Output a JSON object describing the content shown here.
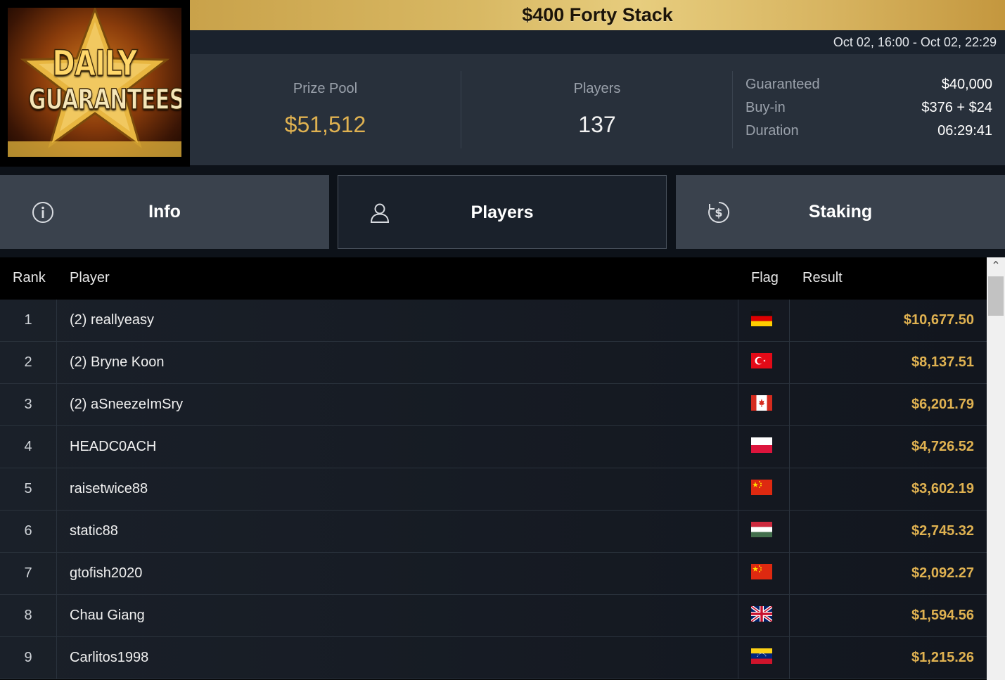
{
  "logo": {
    "line1": "DAILY",
    "line2": "GUARANTEES"
  },
  "tournament": {
    "title": "$400 Forty Stack",
    "date_range": "Oct 02, 16:00 - Oct 02, 22:29"
  },
  "stats": {
    "prize_pool_label": "Prize Pool",
    "prize_pool_value": "$51,512",
    "players_label": "Players",
    "players_value": "137"
  },
  "details": [
    {
      "label": "Guaranteed",
      "value": "$40,000"
    },
    {
      "label": "Buy-in",
      "value": "$376 + $24"
    },
    {
      "label": "Duration",
      "value": "06:29:41"
    }
  ],
  "tabs": [
    {
      "label": "Info",
      "icon": "info-icon",
      "active": false
    },
    {
      "label": "Players",
      "icon": "user-icon",
      "active": true
    },
    {
      "label": "Staking",
      "icon": "dollar-coin-icon",
      "active": false
    }
  ],
  "table": {
    "headers": {
      "rank": "Rank",
      "player": "Player",
      "flag": "Flag",
      "result": "Result"
    },
    "rows": [
      {
        "rank": "1",
        "player": "(2) reallyeasy",
        "flag": "germany",
        "result": "$10,677.50"
      },
      {
        "rank": "2",
        "player": "(2) Bryne Koon",
        "flag": "turkey",
        "result": "$8,137.51"
      },
      {
        "rank": "3",
        "player": "(2) aSneezeImSry",
        "flag": "canada",
        "result": "$6,201.79"
      },
      {
        "rank": "4",
        "player": "HEADC0ACH",
        "flag": "poland",
        "result": "$4,726.52"
      },
      {
        "rank": "5",
        "player": "raisetwice88",
        "flag": "china",
        "result": "$3,602.19"
      },
      {
        "rank": "6",
        "player": "static88",
        "flag": "hungary",
        "result": "$2,745.32"
      },
      {
        "rank": "7",
        "player": "gtofish2020",
        "flag": "china",
        "result": "$2,092.27"
      },
      {
        "rank": "8",
        "player": "Chau Giang",
        "flag": "united-kingdom",
        "result": "$1,594.56"
      },
      {
        "rank": "9",
        "player": "Carlitos1998",
        "flag": "venezuela",
        "result": "$1,215.26"
      }
    ]
  },
  "colors": {
    "gold": "#e0b251",
    "title_bar": "#d8b863",
    "tab_bg": "#3a424d",
    "tab_active_bg": "#1a212b"
  }
}
